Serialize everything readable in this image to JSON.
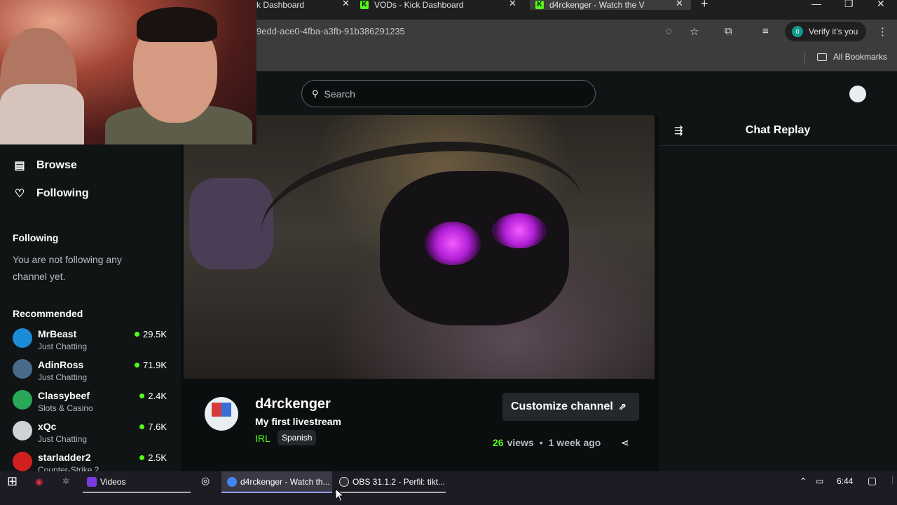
{
  "browser": {
    "tabs": [
      {
        "label": "k Dashboard",
        "active": false
      },
      {
        "label": "VODs - Kick Dashboard",
        "active": false
      },
      {
        "label": "d4rckenger - Watch the V",
        "active": true
      }
    ],
    "url": "9edd-ace0-4fba-a3fb-91b386291235",
    "profile_label": "Verify it's you",
    "profile_initial": "0",
    "all_bookmarks": "All Bookmarks"
  },
  "kick": {
    "search_placeholder": "Search",
    "nav": {
      "browse": "Browse",
      "following": "Following"
    },
    "sidebar": {
      "following_heading": "Following",
      "following_empty": "You are not following any channel yet.",
      "recommended_heading": "Recommended",
      "recommended": [
        {
          "name": "MrBeast",
          "category": "Just Chatting",
          "viewers": "29.5K",
          "color": "#1a8cd8"
        },
        {
          "name": "AdinRoss",
          "category": "Just Chatting",
          "viewers": "71.9K",
          "color": "#4a6a8a"
        },
        {
          "name": "Classybeef",
          "category": "Slots & Casino",
          "viewers": "2.4K",
          "color": "#2aa85a"
        },
        {
          "name": "xQc",
          "category": "Just Chatting",
          "viewers": "7.6K",
          "color": "#cfd3d6"
        },
        {
          "name": "starladder2",
          "category": "Counter-Strike 2",
          "viewers": "2.5K",
          "color": "#d02020"
        }
      ]
    },
    "chat": {
      "title": "Chat Replay"
    },
    "channel": {
      "name": "d4rckenger",
      "stream_title": "My first livestream",
      "category": "IRL",
      "tag": "Spanish",
      "customize_label": "Customize channel",
      "views_count": "26",
      "views_label": "views",
      "age": "1 week ago"
    }
  },
  "taskbar": {
    "items": [
      {
        "label": "Videos",
        "active": false
      },
      {
        "label": "d4rckenger - Watch th...",
        "active": true
      },
      {
        "label": "OBS 31.1.2 - Perfil: tikt...",
        "active": false
      }
    ],
    "time": "6:44"
  },
  "colors": {
    "kick_green": "#53fc18",
    "bg": "#0b0e0f",
    "panel": "#101415"
  }
}
